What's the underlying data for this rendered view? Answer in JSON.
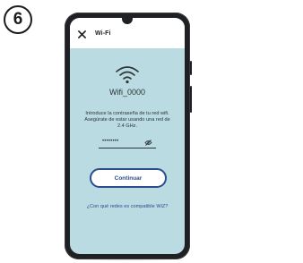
{
  "step": {
    "number": "6"
  },
  "app_bar": {
    "title": "Wi-Fi"
  },
  "network": {
    "name": "Wifi_0000"
  },
  "instructions": {
    "text": "Introduce la contraseña de tu red wifi. Asegúrate de estar usando una red de 2.4 GHz."
  },
  "password_field": {
    "masked_value": "••••••••"
  },
  "continue_button": {
    "label": "Continuar"
  },
  "help_link": {
    "text": "¿Con qué redes es compatible WiZ?"
  },
  "colors": {
    "screen_background": "#b9dbe1",
    "accent": "#2b4d8d",
    "phone_body": "#1f2023"
  },
  "icons": [
    "close-icon",
    "wifi-icon",
    "eye-off-icon"
  ]
}
